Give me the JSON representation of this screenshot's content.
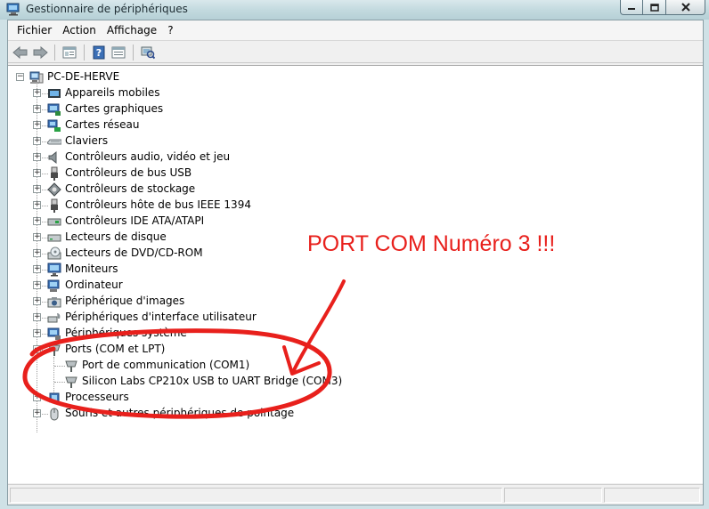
{
  "window": {
    "title": "Gestionnaire de périphériques",
    "controls": [
      "minimize",
      "maximize",
      "close"
    ]
  },
  "menu": {
    "items": [
      "Fichier",
      "Action",
      "Affichage",
      "?"
    ]
  },
  "toolbar": {
    "buttons": [
      "back-arrow-icon",
      "forward-arrow-icon",
      "properties-icon",
      "help-icon",
      "view-icon",
      "scan-hardware-icon"
    ]
  },
  "tree": {
    "root": "PC-DE-HERVE",
    "categories": [
      {
        "label": "Appareils mobiles",
        "icon": "mobile-device-icon"
      },
      {
        "label": "Cartes graphiques",
        "icon": "display-adapter-icon"
      },
      {
        "label": "Cartes réseau",
        "icon": "network-adapter-icon"
      },
      {
        "label": "Claviers",
        "icon": "keyboard-icon"
      },
      {
        "label": "Contrôleurs audio, vidéo et jeu",
        "icon": "speaker-icon"
      },
      {
        "label": "Contrôleurs de bus USB",
        "icon": "usb-icon"
      },
      {
        "label": "Contrôleurs de stockage",
        "icon": "storage-controller-icon"
      },
      {
        "label": "Contrôleurs hôte de bus IEEE 1394",
        "icon": "ieee1394-icon"
      },
      {
        "label": "Contrôleurs IDE ATA/ATAPI",
        "icon": "ide-controller-icon"
      },
      {
        "label": "Lecteurs de disque",
        "icon": "disk-drive-icon"
      },
      {
        "label": "Lecteurs de DVD/CD-ROM",
        "icon": "dvd-drive-icon"
      },
      {
        "label": "Moniteurs",
        "icon": "monitor-icon"
      },
      {
        "label": "Ordinateur",
        "icon": "computer-icon"
      },
      {
        "label": "Périphérique d'images",
        "icon": "imaging-device-icon"
      },
      {
        "label": "Périphériques d'interface utilisateur",
        "icon": "hid-icon"
      },
      {
        "label": "Périphériques système",
        "icon": "system-device-icon"
      },
      {
        "label": "Ports (COM et LPT)",
        "icon": "port-icon",
        "expanded": true,
        "children": [
          {
            "label": "Port de communication (COM1)",
            "icon": "port-icon"
          },
          {
            "label": "Silicon Labs CP210x USB to UART Bridge (COM3)",
            "icon": "port-icon"
          }
        ]
      },
      {
        "label": "Processeurs",
        "icon": "processor-icon"
      },
      {
        "label": "Souris et autres périphériques de pointage",
        "icon": "mouse-icon"
      }
    ]
  },
  "annotation": {
    "text": "PORT COM Numéro 3 !!!",
    "color": "#e8201c"
  }
}
